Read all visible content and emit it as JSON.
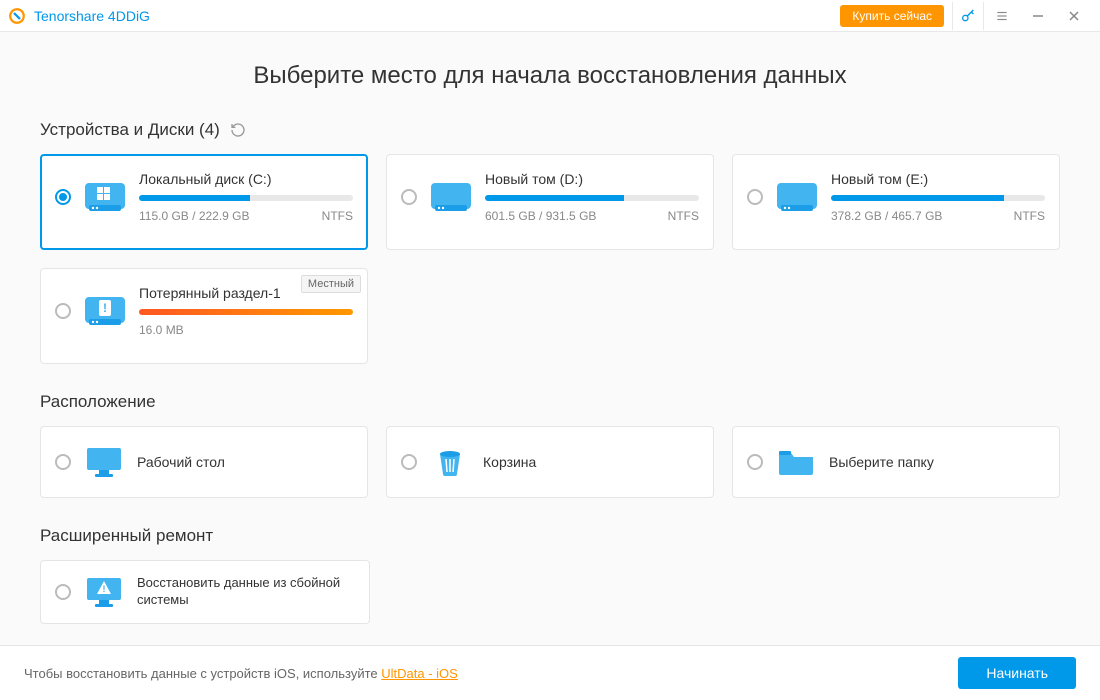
{
  "titlebar": {
    "app_name": "Tenorshare 4DDiG",
    "buy_label": "Купить сейчас"
  },
  "page": {
    "title": "Выберите место для начала восстановления данных"
  },
  "sections": {
    "devices": {
      "label": "Устройства и Диски (4)"
    },
    "locations": {
      "label": "Расположение"
    },
    "advanced": {
      "label": "Расширенный ремонт"
    }
  },
  "drives": [
    {
      "name": "Локальный диск (C:)",
      "used": "115.0 GB",
      "total": "222.9 GB",
      "fs": "NTFS",
      "pct": 52,
      "selected": true,
      "color": "blue",
      "icon": "windows"
    },
    {
      "name": "Новый том (D:)",
      "used": "601.5 GB",
      "total": "931.5 GB",
      "fs": "NTFS",
      "pct": 65,
      "selected": false,
      "color": "blue",
      "icon": "drive"
    },
    {
      "name": "Новый том (E:)",
      "used": "378.2 GB",
      "total": "465.7 GB",
      "fs": "NTFS",
      "pct": 81,
      "selected": false,
      "color": "blue",
      "icon": "drive"
    },
    {
      "name": "Потерянный раздел-1",
      "used": "16.0 MB",
      "total": "",
      "fs": "",
      "pct": 100,
      "selected": false,
      "color": "orange",
      "icon": "lost",
      "badge": "Местный"
    }
  ],
  "locations": [
    {
      "label": "Рабочий стол",
      "icon": "desktop"
    },
    {
      "label": "Корзина",
      "icon": "trash"
    },
    {
      "label": "Выберите папку",
      "icon": "folder"
    }
  ],
  "advanced": [
    {
      "label": "Восстановить данные из сбойной системы",
      "icon": "crashed"
    }
  ],
  "footer": {
    "text_prefix": "Чтобы восстановить данные с устройств iOS, используйте ",
    "link_text": "UltData - iOS",
    "start_label": "Начинать"
  },
  "colors": {
    "accent": "#0098e8",
    "orange": "#ff9500"
  }
}
